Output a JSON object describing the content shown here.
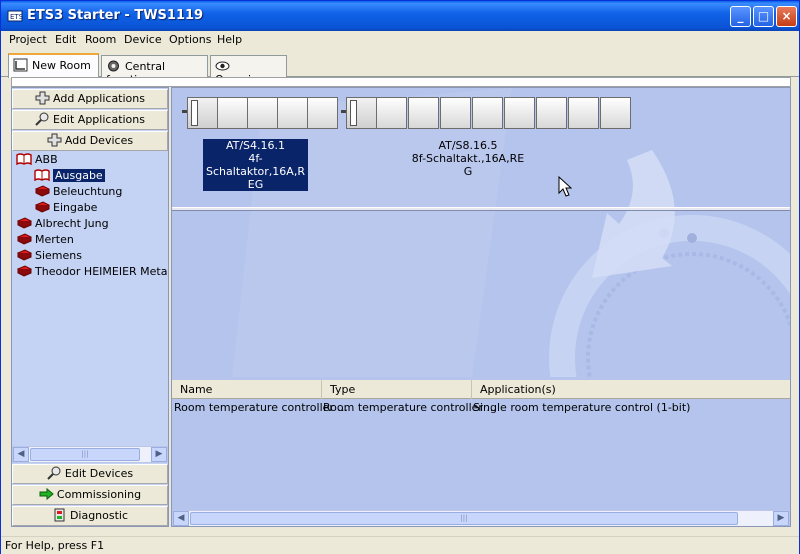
{
  "window": {
    "title": "ETS3 Starter - TWS1119",
    "min_glyph": "_",
    "max_glyph": "□",
    "close_glyph": "×"
  },
  "menu": [
    "Project",
    "Edit",
    "Room",
    "Device",
    "Options",
    "Help"
  ],
  "tabs": [
    {
      "label": "New Room",
      "icon": "room-icon",
      "active": true
    },
    {
      "label": "Central functions",
      "icon": "gear-icon",
      "active": false
    },
    {
      "label": "Overview",
      "icon": "eye-icon",
      "active": false
    }
  ],
  "left_panel": {
    "top_buttons": [
      {
        "label": "Add Applications",
        "icon": "plus-icon"
      },
      {
        "label": "Edit Applications",
        "icon": "magnifier-icon"
      },
      {
        "label": "Add Devices",
        "icon": "plus-icon"
      }
    ],
    "tree": [
      {
        "label": "ABB",
        "level": 0,
        "open": true,
        "selected": false
      },
      {
        "label": "Ausgabe",
        "level": 1,
        "open": true,
        "selected": true
      },
      {
        "label": "Beleuchtung",
        "level": 1,
        "open": false,
        "selected": false
      },
      {
        "label": "Eingabe",
        "level": 1,
        "open": false,
        "selected": false
      },
      {
        "label": "Albrecht Jung",
        "level": 0,
        "open": false,
        "selected": false
      },
      {
        "label": "Merten",
        "level": 0,
        "open": false,
        "selected": false
      },
      {
        "label": "Siemens",
        "level": 0,
        "open": false,
        "selected": false
      },
      {
        "label": "Theodor HEIMEIER Metallwe",
        "level": 0,
        "open": false,
        "selected": false
      }
    ],
    "bottom_buttons": [
      {
        "label": "Edit Devices",
        "icon": "magnifier-icon"
      },
      {
        "label": "Commissioning",
        "icon": "arrow-right-icon"
      },
      {
        "label": "Diagnostic",
        "icon": "diagnostic-icon"
      }
    ]
  },
  "devices": [
    {
      "label": "AT/S4.16.1\n4f-Schaltaktor,16A,R\nEG",
      "modules": 4,
      "selected": true
    },
    {
      "label": "AT/S8.16.5\n8f-Schaltakt.,16A,RE\nG",
      "modules": 8,
      "selected": false
    }
  ],
  "table": {
    "columns": [
      "Name",
      "Type",
      "Application(s)"
    ],
    "rows": [
      [
        "Room temperature controller ...",
        "Room temperature controller ...",
        "Single room temperature control (1-bit)"
      ]
    ]
  },
  "statusbar": {
    "text": "For Help, press F1"
  },
  "scroll": {
    "left_arrow": "◀",
    "right_arrow": "▶",
    "thumb_grip": "|||"
  },
  "colors": {
    "title_blue": "#0a54d6",
    "pane_blue": "#b4c4ec",
    "selection": "#0a246a",
    "active_tab_accent": "#f2a73a"
  }
}
